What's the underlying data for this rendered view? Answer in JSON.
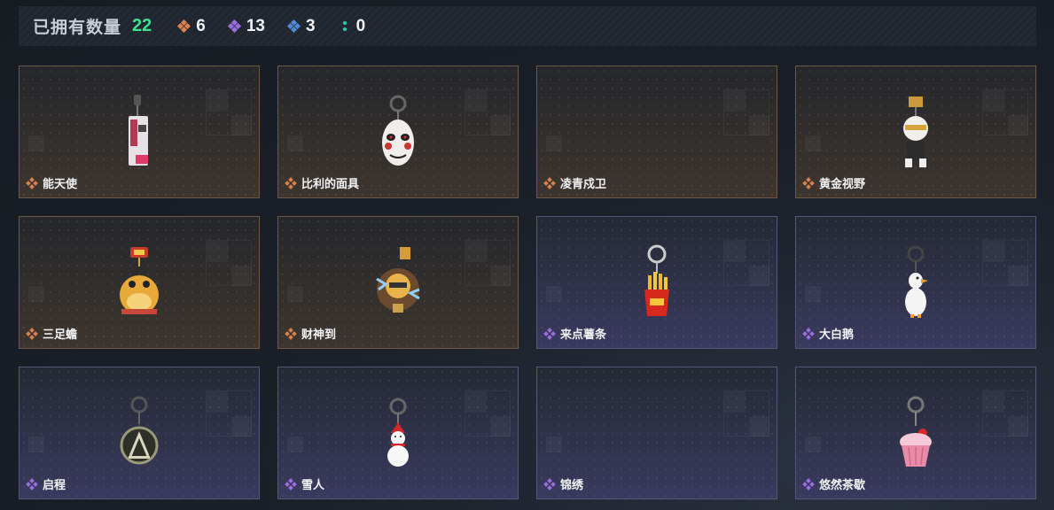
{
  "header": {
    "owned_label": "已拥有数量",
    "owned_count": "22",
    "stats": [
      {
        "icon": "orange-gem-icon",
        "color": "#d9824e",
        "value": "6"
      },
      {
        "icon": "purple-gem-icon",
        "color": "#9b6ee0",
        "value": "13"
      },
      {
        "icon": "blue-gem-icon",
        "color": "#4e8bd6",
        "value": "3"
      },
      {
        "icon": "teal-dots-icon",
        "color": "#2ec9b3",
        "value": "0"
      }
    ]
  },
  "items": [
    {
      "name": "能天使",
      "rarity": "orange",
      "art": "keychain-phone"
    },
    {
      "name": "比利的面具",
      "rarity": "orange",
      "art": "keychain-mask"
    },
    {
      "name": "凌青戍卫",
      "rarity": "orange",
      "art": "none"
    },
    {
      "name": "黄金视野",
      "rarity": "orange",
      "art": "keychain-figure"
    },
    {
      "name": "三足蟾",
      "rarity": "orange",
      "art": "keychain-toad"
    },
    {
      "name": "财神到",
      "rarity": "orange",
      "art": "keychain-fortune"
    },
    {
      "name": "来点薯条",
      "rarity": "purple",
      "art": "keychain-fries"
    },
    {
      "name": "大白鹅",
      "rarity": "purple",
      "art": "keychain-goose"
    },
    {
      "name": "启程",
      "rarity": "purple",
      "art": "keychain-medal"
    },
    {
      "name": "雪人",
      "rarity": "purple",
      "art": "keychain-snowman"
    },
    {
      "name": "锦绣",
      "rarity": "purple",
      "art": "none"
    },
    {
      "name": "悠然茶歇",
      "rarity": "purple",
      "art": "keychain-cupcake"
    }
  ]
}
